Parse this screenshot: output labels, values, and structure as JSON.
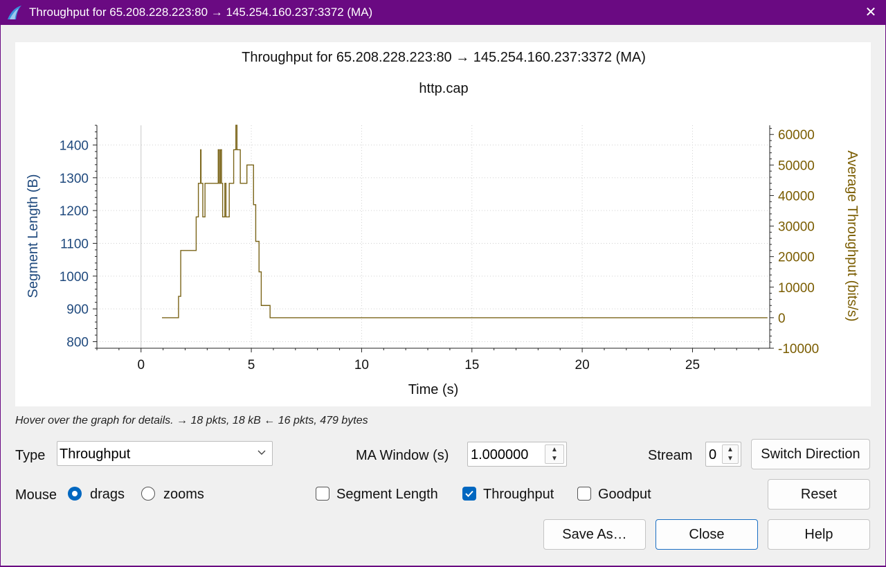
{
  "window": {
    "title": "Throughput for 65.208.228.223:80 → 145.254.160.237:3372 (MA)",
    "close_glyph": "✕",
    "accent_color": "#6a0a82"
  },
  "chart_data": {
    "type": "line",
    "title": "Throughput for 65.208.228.223:80 → 145.254.160.237:3372 (MA)",
    "subtitle": "http.cap",
    "xlabel": "Time (s)",
    "ylabel_left": "Segment Length (B)",
    "ylabel_right": "Average Throughput (bits/s)",
    "xlim": [
      -2,
      28.5
    ],
    "ylim_left": [
      780,
      1460
    ],
    "ylim_right": [
      -10000,
      63000
    ],
    "x_ticks": [
      0,
      5,
      10,
      15,
      20,
      25
    ],
    "y_ticks_left": [
      800,
      900,
      1000,
      1100,
      1200,
      1300,
      1400
    ],
    "y_ticks_right": [
      -10000,
      0,
      10000,
      20000,
      30000,
      40000,
      50000,
      60000
    ],
    "grid": true,
    "left_axis_color": "#1f497d",
    "right_axis_color": "#7a5c00",
    "series": [
      {
        "name": "Average Throughput (bits/s)",
        "axis": "right",
        "color": "#7a6418",
        "step": true,
        "x": [
          0.95,
          1.7,
          1.8,
          1.85,
          2.5,
          2.6,
          2.7,
          2.72,
          2.8,
          2.9,
          2.95,
          3.5,
          3.55,
          3.6,
          3.65,
          3.7,
          3.8,
          3.85,
          4.0,
          4.2,
          4.3,
          4.35,
          4.4,
          4.5,
          4.7,
          4.8,
          4.95,
          5.1,
          5.2,
          5.35,
          5.45,
          5.55,
          5.85,
          28.4
        ],
        "y": [
          0,
          7000,
          22000,
          22000,
          33000,
          44000,
          55000,
          44000,
          33000,
          44000,
          44000,
          55000,
          44000,
          55000,
          44000,
          33000,
          44000,
          33000,
          44000,
          55000,
          63000,
          55000,
          55000,
          44000,
          44000,
          50000,
          50000,
          37000,
          25000,
          15000,
          4000,
          4000,
          0,
          0
        ]
      }
    ]
  },
  "status": {
    "hint": "Hover over the graph for details. → 18 pkts, 18 kB ← 16 pkts, 479 bytes"
  },
  "controls": {
    "type_label": "Type",
    "type_value": "Throughput",
    "ma_label": "MA Window (s)",
    "ma_value": "1.000000",
    "stream_label": "Stream",
    "stream_value": "0",
    "switch_direction": "Switch Direction",
    "mouse_label": "Mouse",
    "mouse_drags": "drags",
    "mouse_zooms": "zooms",
    "mouse_mode": "drags",
    "segment_length": "Segment Length",
    "throughput": "Throughput",
    "goodput": "Goodput",
    "segment_length_checked": false,
    "throughput_checked": true,
    "goodput_checked": false,
    "reset": "Reset",
    "save_as": "Save As…",
    "close": "Close",
    "help": "Help"
  }
}
